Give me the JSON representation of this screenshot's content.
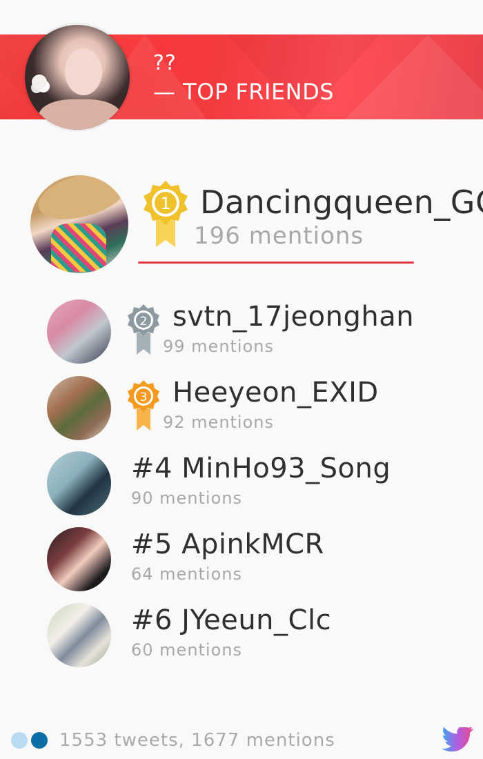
{
  "header": {
    "username": "??",
    "title": "— TOP FRIENDS"
  },
  "friends": [
    {
      "rank": 1,
      "name": "Dancingqueen_GG",
      "mentions": "196 mentions",
      "medal_color": "#efc12c"
    },
    {
      "rank": 2,
      "name": "svtn_17jeonghan",
      "mentions": "99 mentions",
      "medal_color": "#8d9aa1"
    },
    {
      "rank": 3,
      "name": "Heeyeon_EXID",
      "mentions": "92 mentions",
      "medal_color": "#f39a1f"
    },
    {
      "rank": 4,
      "name": "#4  MinHo93_Song",
      "mentions": "90 mentions"
    },
    {
      "rank": 5,
      "name": "#5  ApinkMCR",
      "mentions": "64 mentions"
    },
    {
      "rank": 6,
      "name": "#6  JYeeun_Clc",
      "mentions": "60 mentions"
    }
  ],
  "medal_labels": [
    "1",
    "2",
    "3"
  ],
  "footer": {
    "stats": "1553  tweets,  1677  mentions"
  },
  "colors": {
    "accent": "#f33a3f",
    "underline": "#e3353f",
    "twitter_gradient": [
      "#3aa7f0",
      "#b25de0",
      "#ec4a8c"
    ]
  }
}
